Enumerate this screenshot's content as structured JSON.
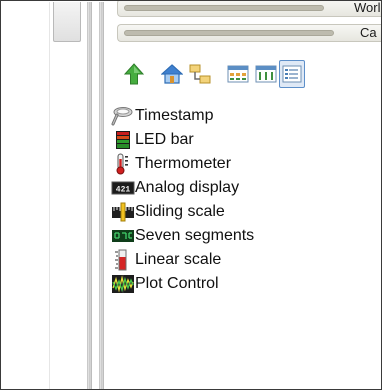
{
  "panel": {
    "header_label": "Worl",
    "subheader_label": "Ca"
  },
  "toolbar": {
    "buttons": [
      {
        "name": "up-arrow-icon",
        "color": "#3aa13a"
      },
      {
        "name": "home-icon",
        "color": "#3b78c8"
      },
      {
        "name": "hierarchy-icon",
        "color": "#d8b24a"
      },
      {
        "name": "large-icons-view-icon",
        "color": "#4a7fb5"
      },
      {
        "name": "small-icons-view-icon",
        "color": "#4a7fb5"
      },
      {
        "name": "list-view-icon",
        "color": "#4a7fb5",
        "pressed": true
      }
    ]
  },
  "components": [
    {
      "label": "Timestamp",
      "icon": "timestamp-icon"
    },
    {
      "label": "LED bar",
      "icon": "led-bar-icon"
    },
    {
      "label": "Thermometer",
      "icon": "thermometer-icon"
    },
    {
      "label": "Analog display",
      "icon": "analog-display-icon",
      "icon_text": "421"
    },
    {
      "label": "Sliding scale",
      "icon": "sliding-scale-icon"
    },
    {
      "label": "Seven segments",
      "icon": "seven-segments-icon"
    },
    {
      "label": "Linear scale",
      "icon": "linear-scale-icon"
    },
    {
      "label": "Plot Control",
      "icon": "plot-control-icon"
    }
  ]
}
